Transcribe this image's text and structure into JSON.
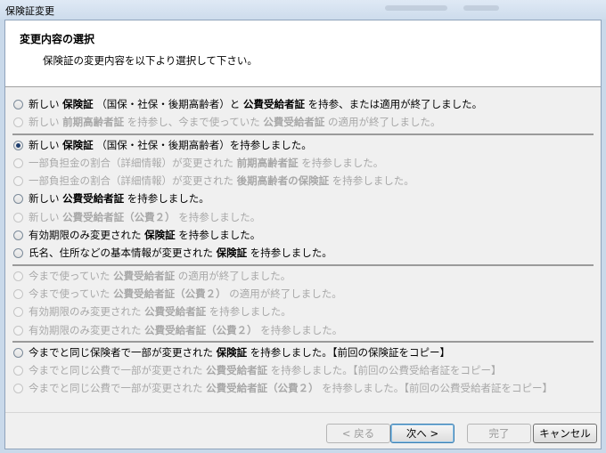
{
  "window": {
    "title": "保険証変更"
  },
  "header": {
    "title": "変更内容の選択",
    "description": "保険証の変更内容を以下より選択して下さい。"
  },
  "groups": [
    [
      {
        "parts": [
          "新しい ",
          {
            "b": "保険証"
          },
          " （国保・社保・後期高齢者）と ",
          {
            "b": "公費受給者証"
          },
          " を持参、または適用が終了しました。"
        ],
        "enabled": true,
        "checked": false
      },
      {
        "parts": [
          "新しい ",
          {
            "b": "前期高齢者証"
          },
          " を持参し、今まで使っていた ",
          {
            "b": "公費受給者証"
          },
          " の適用が終了しました。"
        ],
        "enabled": false,
        "checked": false
      }
    ],
    [
      {
        "parts": [
          "新しい ",
          {
            "b": "保険証"
          },
          " （国保・社保・後期高齢者）を持参しました。"
        ],
        "enabled": true,
        "checked": true
      },
      {
        "parts": [
          "一部負担金の割合（詳細情報）が変更された ",
          {
            "b": "前期高齢者証"
          },
          " を持参しました。"
        ],
        "enabled": false,
        "checked": false
      },
      {
        "parts": [
          "一部負担金の割合（詳細情報）が変更された ",
          {
            "b": "後期高齢者の保険証"
          },
          " を持参しました。"
        ],
        "enabled": false,
        "checked": false
      },
      {
        "parts": [
          "新しい ",
          {
            "b": "公費受給者証"
          },
          " を持参しました。"
        ],
        "enabled": true,
        "checked": false
      },
      {
        "parts": [
          "新しい ",
          {
            "b": "公費受給者証（公費２）"
          },
          " を持参しました。"
        ],
        "enabled": false,
        "checked": false
      },
      {
        "parts": [
          "有効期限のみ変更された ",
          {
            "b": "保険証"
          },
          " を持参しました。"
        ],
        "enabled": true,
        "checked": false
      },
      {
        "parts": [
          "氏名、住所などの基本情報が変更された ",
          {
            "b": "保険証"
          },
          " を持参しました。"
        ],
        "enabled": true,
        "checked": false
      }
    ],
    [
      {
        "parts": [
          "今まで使っていた ",
          {
            "b": "公費受給者証"
          },
          " の適用が終了しました。"
        ],
        "enabled": false,
        "checked": false
      },
      {
        "parts": [
          "今まで使っていた ",
          {
            "b": "公費受給者証（公費２）"
          },
          " の適用が終了しました。"
        ],
        "enabled": false,
        "checked": false
      },
      {
        "parts": [
          "有効期限のみ変更された ",
          {
            "b": "公費受給者証"
          },
          " を持参しました。"
        ],
        "enabled": false,
        "checked": false
      },
      {
        "parts": [
          "有効期限のみ変更された ",
          {
            "b": "公費受給者証（公費２）"
          },
          " を持参しました。"
        ],
        "enabled": false,
        "checked": false
      }
    ],
    [
      {
        "parts": [
          "今までと同じ保険者で一部が変更された ",
          {
            "b": "保険証"
          },
          " を持参しました。【前回の保険証をコピー】"
        ],
        "enabled": true,
        "checked": false
      },
      {
        "parts": [
          "今までと同じ公費で一部が変更された ",
          {
            "b": "公費受給者証"
          },
          " を持参しました。【前回の公費受給者証をコピー】"
        ],
        "enabled": false,
        "checked": false
      },
      {
        "parts": [
          "今までと同じ公費で一部が変更された ",
          {
            "b": "公費受給者証（公費２）"
          },
          " を持参しました。【前回の公費受給者証をコピー】"
        ],
        "enabled": false,
        "checked": false
      }
    ]
  ],
  "buttons": {
    "back": "< 戻る",
    "next": "次へ >",
    "finish": "完了",
    "cancel": "キャンセル"
  }
}
